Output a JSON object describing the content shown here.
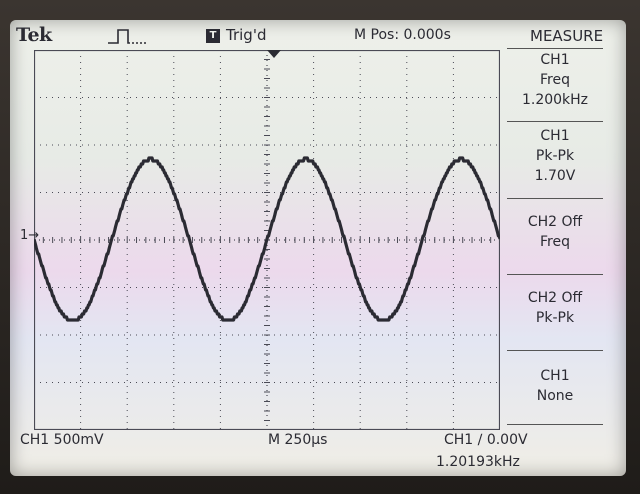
{
  "header": {
    "brand": "Tek",
    "trigger_icon_glyph": "T",
    "trigger_status": "Trig'd",
    "horizontal_position": "M Pos: 0.000s"
  },
  "menu": {
    "title": "MEASURE",
    "items": [
      {
        "line1": "CH1",
        "line2": "Freq",
        "line3": "1.200kHz"
      },
      {
        "line1": "CH1",
        "line2": "Pk-Pk",
        "line3": "1.70V"
      },
      {
        "line1": "CH2 Off",
        "line2": "Freq",
        "line3": ""
      },
      {
        "line1": "CH2 Off",
        "line2": "Pk-Pk",
        "line3": ""
      },
      {
        "line1": "CH1",
        "line2": "None",
        "line3": ""
      }
    ]
  },
  "footer": {
    "ch1_scale": "CH1  500mV",
    "timebase": "M 250µs",
    "trigger": "CH1 ∕ 0.00V",
    "frequency_counter": "1.20193kHz"
  },
  "channel_marker": "1→",
  "colors": {
    "trace": "#2b2b33",
    "graticule": "#4a4a55",
    "screen_bg": "#eef0ea"
  },
  "chart_data": {
    "type": "line",
    "title": "",
    "xlabel": "",
    "ylabel": "",
    "divisions": {
      "x": 10,
      "y": 8
    },
    "volts_per_div": 0.5,
    "seconds_per_div": 0.00025,
    "xlim": [
      -0.00125,
      0.00125
    ],
    "ylim": [
      -2.0,
      2.0
    ],
    "series": [
      {
        "frequency_hz": 1200,
        "peak_to_peak_v": 1.7,
        "offset_v": 0.0,
        "start_phase_deg": 180
      }
    ]
  }
}
